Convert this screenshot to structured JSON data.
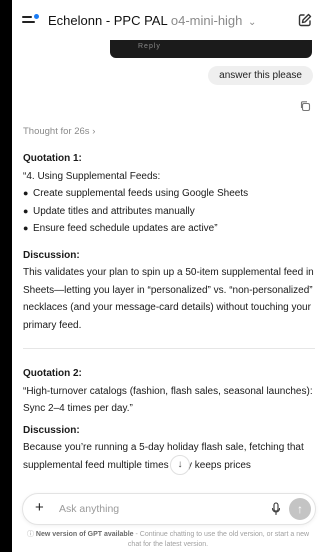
{
  "header": {
    "title": "Echelonn - PPC PAL",
    "model": "o4-mini-high"
  },
  "toolbar": {
    "label": "Reply"
  },
  "user_message": "answer this please",
  "thought_label": "Thought for 26s",
  "quotation1": {
    "heading": "Quotation 1:",
    "intro": "“4. Using Supplemental Feeds:",
    "bullets": [
      "Create supplemental feeds using Google Sheets",
      "Update titles and attributes manually",
      "Ensure feed schedule updates are active”"
    ]
  },
  "discussion1": {
    "heading": "Discussion:",
    "text": "This validates your plan to spin up a 50-item supplemental feed in Sheets—letting you layer in “personalized” vs. “non-personalized” necklaces (and your message-card details) without touching your primary feed."
  },
  "quotation2": {
    "heading": "Quotation 2:",
    "text": "“High-turnover catalogs (fashion, flash sales, seasonal launches): Sync 2–4 times per day.”"
  },
  "discussion2": {
    "heading": "Discussion:",
    "text": "Because you’re running a 5-day holiday flash sale, fetching that supplemental feed multiple times daily keeps prices"
  },
  "composer": {
    "placeholder": "Ask anything"
  },
  "notice": {
    "headline": "New version of GPT available",
    "text": " - Continue chatting to use the old version, or start a new chat for the latest version."
  }
}
